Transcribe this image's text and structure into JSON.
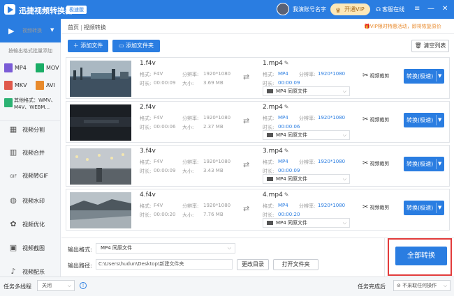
{
  "titlebar": {
    "app_title": "迅捷视频转换器",
    "badge": "极速版",
    "user_name": "我演账号名字",
    "vip_button": "开通VIP",
    "vip_icon": "crown-icon",
    "service": "客服在线",
    "service_icon": "headset-icon",
    "menu_glyph": "≡",
    "minimize_glyph": "—",
    "close_glyph": "✕"
  },
  "sidebar": {
    "active": {
      "label": "视频转换",
      "icon": "video-convert-icon",
      "chevron": "▼"
    },
    "hint": "按输出格式批量添加",
    "formats": [
      "MP4",
      "MOV",
      "MKV",
      "AVI"
    ],
    "other_formats": [
      "其他格式：WMV、",
      "M4V、WEBM..."
    ],
    "items": [
      {
        "label": "视频分割",
        "icon": "split-icon",
        "glyph": "▦"
      },
      {
        "label": "视频合并",
        "icon": "merge-icon",
        "glyph": "▥"
      },
      {
        "label": "视频转GIF",
        "icon": "gif-icon",
        "glyph": "GIF"
      },
      {
        "label": "视频水印",
        "icon": "watermark-icon",
        "glyph": "◍"
      },
      {
        "label": "视频优化",
        "icon": "optimize-icon",
        "glyph": "✿"
      },
      {
        "label": "视频截图",
        "icon": "screenshot-icon",
        "glyph": "▣"
      },
      {
        "label": "视频配乐",
        "icon": "music-icon",
        "glyph": "♪"
      }
    ]
  },
  "breadcrumb": {
    "home": "首页",
    "sep": "|",
    "current": "视频转换"
  },
  "notice": "VIP限时特惠活动，即将恢复原价",
  "toolbar": {
    "add_file": "添加文件",
    "add_folder": "添加文件夹",
    "clear": "清空列表"
  },
  "labels": {
    "format": "格式:",
    "resolution": "分辨率:",
    "duration": "时长:",
    "size": "大小:",
    "clip": "视频裁剪",
    "convert": "转换(极速)",
    "same_as_source": "同原文件"
  },
  "files": [
    {
      "name": "1.f4v",
      "format": "F4V",
      "resolution": "1920*1080",
      "duration": "00:00:09",
      "size": "3.69 MB",
      "out_name": "1.mp4",
      "out_format": "MP4",
      "out_resolution": "1920*1080",
      "out_duration": "00:00:09",
      "out_select": "MP4"
    },
    {
      "name": "2.f4v",
      "format": "F4V",
      "resolution": "1920*1080",
      "duration": "00:00:06",
      "size": "2.37 MB",
      "out_name": "2.mp4",
      "out_format": "MP4",
      "out_resolution": "1920*1080",
      "out_duration": "00:00:06",
      "out_select": "MP4"
    },
    {
      "name": "3.f4v",
      "format": "F4V",
      "resolution": "1920*1080",
      "duration": "00:00:09",
      "size": "3.43 MB",
      "out_name": "3.mp4",
      "out_format": "MP4",
      "out_resolution": "1920*1080",
      "out_duration": "00:00:09",
      "out_select": "MP4"
    },
    {
      "name": "4.f4v",
      "format": "F4V",
      "resolution": "1920*1080",
      "duration": "00:00:20",
      "size": "7.76 MB",
      "out_name": "4.mp4",
      "out_format": "MP4",
      "out_resolution": "1920*1080",
      "out_duration": "00:00:20",
      "out_select": "MP4"
    }
  ],
  "bottom": {
    "output_format_label": "输出格式:",
    "output_format_value": "MP4  同原文件",
    "output_path_label": "输出路径:",
    "output_path_value": "C:\\Users\\hudun\\Desktop\\新建文件夹",
    "change_dir": "更改目录",
    "open_folder": "打开文件夹",
    "convert_all": "全部转换"
  },
  "status": {
    "multithread_label": "任务多线程",
    "multithread_value": "关闭",
    "after_label": "任务完成后",
    "after_value": "不采取任何操作"
  }
}
